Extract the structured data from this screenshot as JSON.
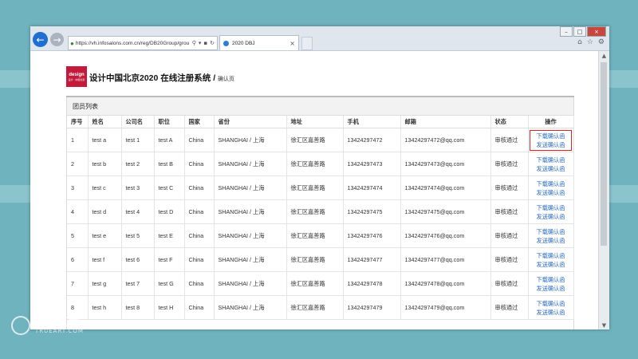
{
  "browser": {
    "url": "https://vh.infosalons.com.cn/reg/DB20Group/grou",
    "tab_title": "2020 DBJ"
  },
  "page": {
    "logo_text": "design",
    "logo_sub": "设计 · 中国北京",
    "title": "设计中国北京2020 在线注册系统 / ",
    "subtitle": "确认页"
  },
  "panel": {
    "title": "团员列表",
    "columns": [
      "序号",
      "姓名",
      "公司名",
      "职位",
      "国家",
      "省份",
      "地址",
      "手机",
      "邮箱",
      "状态",
      "操作"
    ],
    "rows": [
      {
        "no": "1",
        "name": "test a",
        "company": "test 1",
        "title": "test A",
        "country": "China",
        "province": "SHANGHAI / 上海",
        "address": "徐汇区嘉善路",
        "phone": "13424297472",
        "email": "13424297472@qq.com",
        "status": "审核通过",
        "op1": "下载确认函",
        "op2": "发送确认函"
      },
      {
        "no": "2",
        "name": "test b",
        "company": "test 2",
        "title": "test B",
        "country": "China",
        "province": "SHANGHAI / 上海",
        "address": "徐汇区嘉善路",
        "phone": "13424297473",
        "email": "13424297473@qq.com",
        "status": "审核通过",
        "op1": "下载确认函",
        "op2": "发送确认函"
      },
      {
        "no": "3",
        "name": "test c",
        "company": "test 3",
        "title": "test C",
        "country": "China",
        "province": "SHANGHAI / 上海",
        "address": "徐汇区嘉善路",
        "phone": "13424297474",
        "email": "13424297474@qq.com",
        "status": "审核通过",
        "op1": "下载确认函",
        "op2": "发送确认函"
      },
      {
        "no": "4",
        "name": "test d",
        "company": "test 4",
        "title": "test D",
        "country": "China",
        "province": "SHANGHAI / 上海",
        "address": "徐汇区嘉善路",
        "phone": "13424297475",
        "email": "13424297475@qq.com",
        "status": "审核通过",
        "op1": "下载确认函",
        "op2": "发送确认函"
      },
      {
        "no": "5",
        "name": "test e",
        "company": "test 5",
        "title": "test E",
        "country": "China",
        "province": "SHANGHAI / 上海",
        "address": "徐汇区嘉善路",
        "phone": "13424297476",
        "email": "13424297476@qq.com",
        "status": "审核通过",
        "op1": "下载确认函",
        "op2": "发送确认函"
      },
      {
        "no": "6",
        "name": "test f",
        "company": "test 6",
        "title": "test F",
        "country": "China",
        "province": "SHANGHAI / 上海",
        "address": "徐汇区嘉善路",
        "phone": "13424297477",
        "email": "13424297477@qq.com",
        "status": "审核通过",
        "op1": "下载确认函",
        "op2": "发送确认函"
      },
      {
        "no": "7",
        "name": "test g",
        "company": "test 7",
        "title": "test G",
        "country": "China",
        "province": "SHANGHAI / 上海",
        "address": "徐汇区嘉善路",
        "phone": "13424297478",
        "email": "13424297478@qq.com",
        "status": "审核通过",
        "op1": "下载确认函",
        "op2": "发送确认函"
      },
      {
        "no": "8",
        "name": "test h",
        "company": "test 8",
        "title": "test H",
        "country": "China",
        "province": "SHANGHAI / 上海",
        "address": "徐汇区嘉善路",
        "phone": "13424297479",
        "email": "13424297479@qq.com",
        "status": "审核通过",
        "op1": "下载确认函",
        "op2": "发送确认函"
      }
    ]
  },
  "watermark": {
    "text": "典真艺术",
    "sub": "TRUEART.COM"
  },
  "colors": {
    "background": "#6fb3bf",
    "logo": "#c3193a",
    "link": "#2a6bc0",
    "highlight": "#d9251d"
  }
}
